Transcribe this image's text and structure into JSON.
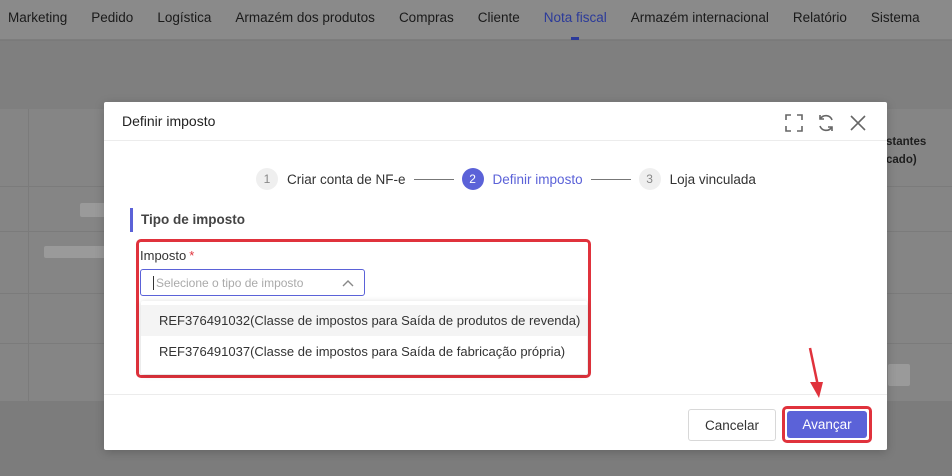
{
  "nav": {
    "items": [
      {
        "label": "Marketing"
      },
      {
        "label": "Pedido"
      },
      {
        "label": "Logística"
      },
      {
        "label": "Armazém dos produtos"
      },
      {
        "label": "Compras"
      },
      {
        "label": "Cliente"
      },
      {
        "label": "Nota fiscal",
        "active": true
      },
      {
        "label": "Armazém internacional"
      },
      {
        "label": "Relatório"
      },
      {
        "label": "Sistema"
      }
    ]
  },
  "background": {
    "header_partial_line1": "stantes",
    "header_partial_line2": "cado)"
  },
  "modal": {
    "title": "Definir imposto",
    "icons": [
      "fullscreen-icon",
      "refresh-icon",
      "close-icon"
    ],
    "steps": [
      {
        "num": "1",
        "label": "Criar conta de NF-e",
        "state": "inactive"
      },
      {
        "num": "2",
        "label": "Definir imposto",
        "state": "active"
      },
      {
        "num": "3",
        "label": "Loja vinculada",
        "state": "inactive"
      }
    ],
    "section_title": "Tipo de imposto",
    "field": {
      "label": "Imposto",
      "required_mark": "*",
      "placeholder": "Selecione o tipo de imposto",
      "options": [
        "REF376491032(Classe de impostos para Saída de produtos de revenda)",
        "REF376491037(Classe de impostos para Saída de fabricação própria)"
      ]
    },
    "footer": {
      "cancel_label": "Cancelar",
      "next_label": "Avançar"
    }
  },
  "colors": {
    "accent": "#5b62d8",
    "highlight": "#e0323c"
  }
}
